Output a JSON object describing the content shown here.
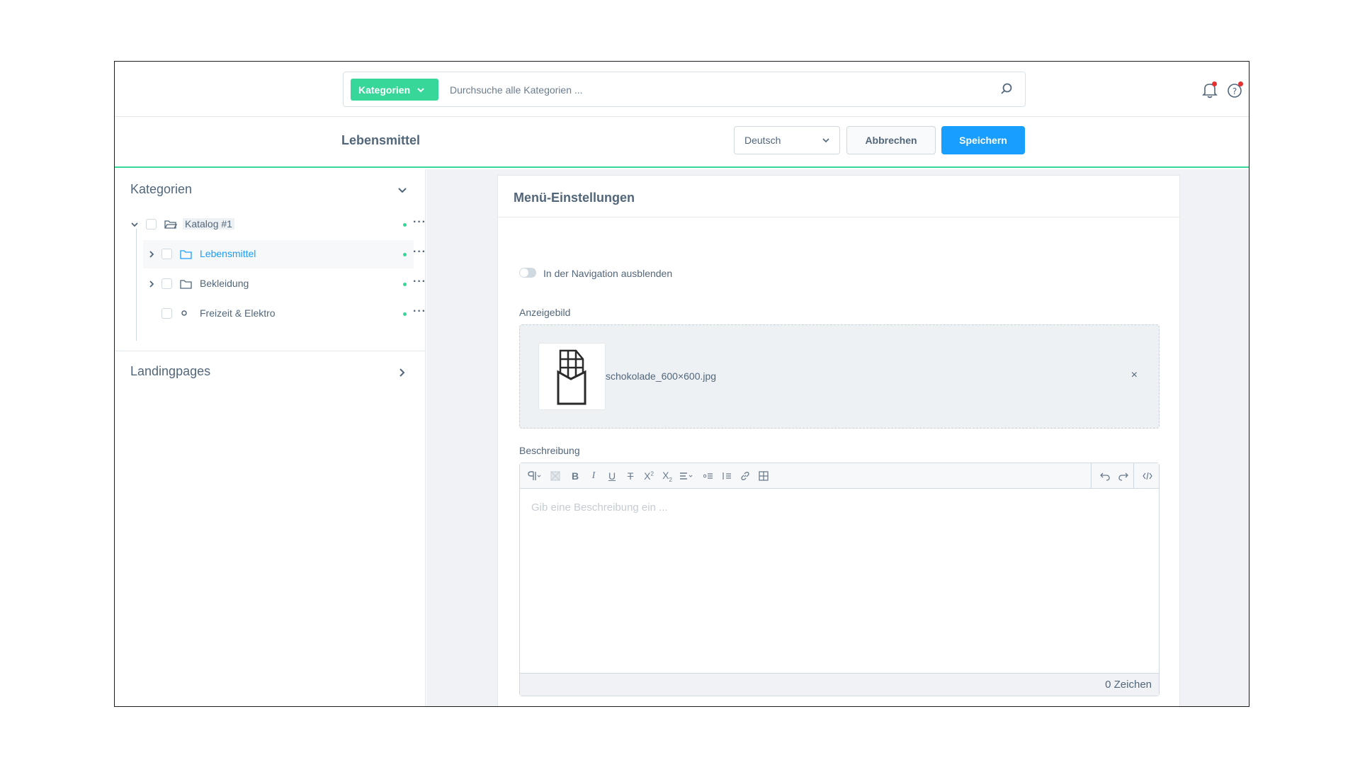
{
  "header": {
    "search_type_label": "Kategorien",
    "search_placeholder": "Durchsuche alle Kategorien ...",
    "accent_color": "#37d79a"
  },
  "actionbar": {
    "title": "Lebensmittel",
    "language": "Deutsch",
    "cancel_label": "Abbrechen",
    "save_label": "Speichern",
    "primary_color": "#189eff"
  },
  "sidebar": {
    "categories_title": "Kategorien",
    "landingpages_title": "Landingpages",
    "tree": [
      {
        "label": "Katalog #1",
        "icon": "folder-open-icon",
        "expanded": true,
        "level": 0
      },
      {
        "label": "Lebensmittel",
        "icon": "folder-icon",
        "expanded": false,
        "level": 1,
        "active": true
      },
      {
        "label": "Bekleidung",
        "icon": "folder-icon",
        "expanded": false,
        "level": 1
      },
      {
        "label": "Freizeit & Elektro",
        "icon": "circle-icon",
        "expanded": false,
        "level": 1
      }
    ]
  },
  "main": {
    "card_title": "Menü-Einstellungen",
    "hide_in_nav_label": "In der Navigation ausblenden",
    "display_image_label": "Anzeigebild",
    "file_name": "schokolade_600×600.jpg",
    "remove_label": "×",
    "description_label": "Beschreibung",
    "description_placeholder": "Gib eine Beschreibung ein ...",
    "char_count": "0 Zeichen"
  }
}
